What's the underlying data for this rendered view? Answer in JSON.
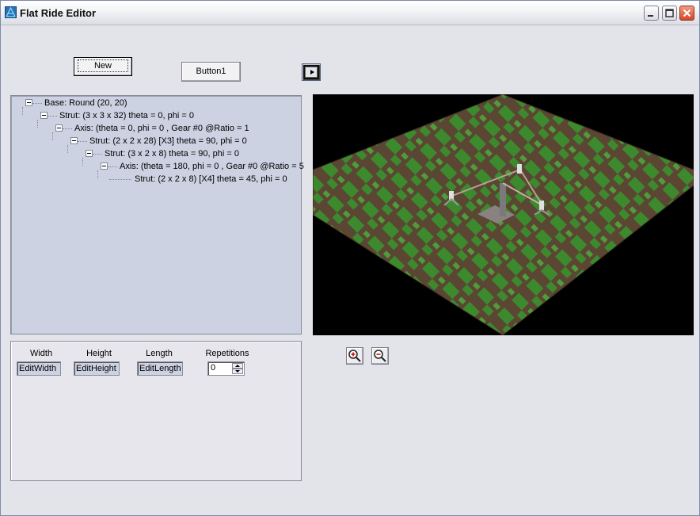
{
  "window": {
    "title": "Flat Ride Editor",
    "icon": "app-icon",
    "controls": [
      "minimize-icon",
      "maximize-icon",
      "close-icon"
    ]
  },
  "toolbar": {
    "new_label": "New",
    "button1_label": "Button1",
    "play_icon": "play-icon"
  },
  "tree": {
    "nodes": [
      {
        "label": "Base: Round (20, 20)",
        "level": 0
      },
      {
        "label": "Strut: (3 x 3 x 32) theta = 0, phi = 0",
        "level": 1
      },
      {
        "label": "Axis: (theta = 0, phi = 0 , Gear #0 @Ratio = 1",
        "level": 2
      },
      {
        "label": "Strut: (2 x 2 x 28) [X3] theta = 90, phi = 0",
        "level": 3
      },
      {
        "label": "Strut: (3 x 2 x 8) theta = 90, phi = 0",
        "level": 4
      },
      {
        "label": "Axis: (theta = 180, phi = 0 , Gear #0 @Ratio = 5",
        "level": 5
      },
      {
        "label": "Strut: (2 x 2 x 8) [X4] theta = 45, phi = 0",
        "level": 6
      }
    ]
  },
  "properties": {
    "width_label": "Width",
    "height_label": "Height",
    "length_label": "Length",
    "repetitions_label": "Repetitions",
    "width_value": "EditWidth",
    "height_value": "EditHeight",
    "length_value": "EditLength",
    "repetitions_value": "0"
  },
  "zoom": {
    "in_icon": "zoom-in-icon",
    "out_icon": "zoom-out-icon"
  },
  "colors": {
    "grass": "#3d8a2e",
    "dirt": "#5a4632",
    "tree_bg": "#ccd2e2"
  }
}
